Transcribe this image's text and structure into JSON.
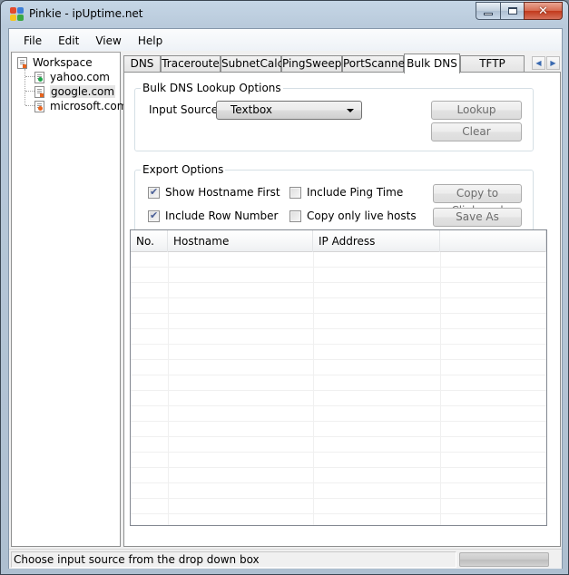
{
  "window": {
    "title": "Pinkie - ipUptime.net",
    "icon": "puzzle-app-icon",
    "caption_buttons": [
      "minimize",
      "maximize",
      "close"
    ]
  },
  "menu": {
    "items": [
      {
        "label": "File"
      },
      {
        "label": "Edit"
      },
      {
        "label": "View"
      },
      {
        "label": "Help"
      }
    ]
  },
  "tree": {
    "root": {
      "label": "Workspace",
      "icon": "document-icon"
    },
    "children": [
      {
        "label": "yahoo.com",
        "icon": "host-icon",
        "status_color": "#1fa64a"
      },
      {
        "label": "google.com",
        "icon": "document-icon",
        "status_color": "#e8641e",
        "selected": true
      },
      {
        "label": "microsoft.com",
        "icon": "host-icon",
        "status_color": "#e8641e"
      }
    ]
  },
  "tabs": {
    "items": [
      {
        "label": "DNS"
      },
      {
        "label": "Traceroute"
      },
      {
        "label": "SubnetCalc"
      },
      {
        "label": "PingSweep"
      },
      {
        "label": "PortScanner"
      },
      {
        "label": "Bulk DNS",
        "active": true
      },
      {
        "label": "TFTP Server"
      }
    ],
    "scroll_left": "◀",
    "scroll_right": "▶"
  },
  "lookup_options": {
    "title": "Bulk DNS Lookup Options",
    "input_source_label": "Input Source:",
    "input_source_value": "Textbox",
    "lookup_button": "Lookup",
    "clear_button": "Clear"
  },
  "export_options": {
    "title": "Export Options",
    "checkboxes": [
      {
        "label": "Show Hostname First",
        "checked": true
      },
      {
        "label": "Include Row Number",
        "checked": true
      },
      {
        "label": "Include Ping Time",
        "checked": false
      },
      {
        "label": "Copy only live hosts",
        "checked": false
      }
    ],
    "copy_button": "Copy to Clipboard",
    "save_button": "Save As"
  },
  "results_table": {
    "columns": [
      "No.",
      "Hostname",
      "IP Address",
      ""
    ],
    "rows": []
  },
  "statusbar": {
    "text": "Choose input source from the drop down box",
    "progress": 0
  },
  "colors": {
    "accent_check": "#4a5f97",
    "status_ok": "#1fa64a",
    "status_warn": "#e8641e"
  }
}
